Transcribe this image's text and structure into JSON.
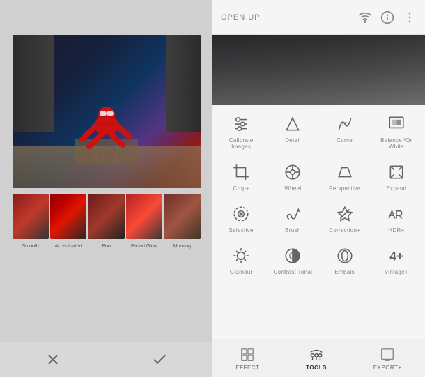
{
  "left": {
    "filter_labels": [
      "Smooth",
      "Accentuated",
      "Poo",
      "Faded Glow",
      "Morning"
    ]
  },
  "right": {
    "header": {
      "title": "OPEN UP"
    },
    "tools": [
      [
        {
          "id": "calibrate",
          "label": "Calibrate Images",
          "icon": "sliders"
        },
        {
          "id": "detail",
          "label": "Detail",
          "icon": "triangle"
        },
        {
          "id": "curve",
          "label": "Curve",
          "icon": "curve"
        },
        {
          "id": "balance",
          "label": "Balance \\Or White",
          "icon": "balance"
        }
      ],
      [
        {
          "id": "crop",
          "label": "Crop+",
          "icon": "crop"
        },
        {
          "id": "wheel",
          "label": "Wheel",
          "icon": "wheel"
        },
        {
          "id": "perspective",
          "label": "Perspective",
          "icon": "perspective"
        },
        {
          "id": "expand",
          "label": "Expand",
          "icon": "expand"
        }
      ],
      [
        {
          "id": "selective",
          "label": "Selective",
          "icon": "selective"
        },
        {
          "id": "brush",
          "label": "Brush",
          "icon": "brush"
        },
        {
          "id": "correction",
          "label": "Correction+",
          "icon": "correction"
        },
        {
          "id": "hdr",
          "label": "HDR+",
          "icon": "hdr"
        }
      ],
      [
        {
          "id": "glamour",
          "label": "Glamour",
          "icon": "glamour"
        },
        {
          "id": "contrast_tonal",
          "label": "Contrast Tonal",
          "icon": "contrast_tonal"
        },
        {
          "id": "embals",
          "label": "Embals",
          "icon": "embals"
        },
        {
          "id": "vintage",
          "label": "Vintage+",
          "icon": "vintage"
        }
      ]
    ],
    "nav": [
      {
        "id": "effect",
        "label": "EFFECT"
      },
      {
        "id": "tools",
        "label": "TOOLS",
        "active": true
      },
      {
        "id": "export",
        "label": "EXPORT+"
      }
    ]
  }
}
